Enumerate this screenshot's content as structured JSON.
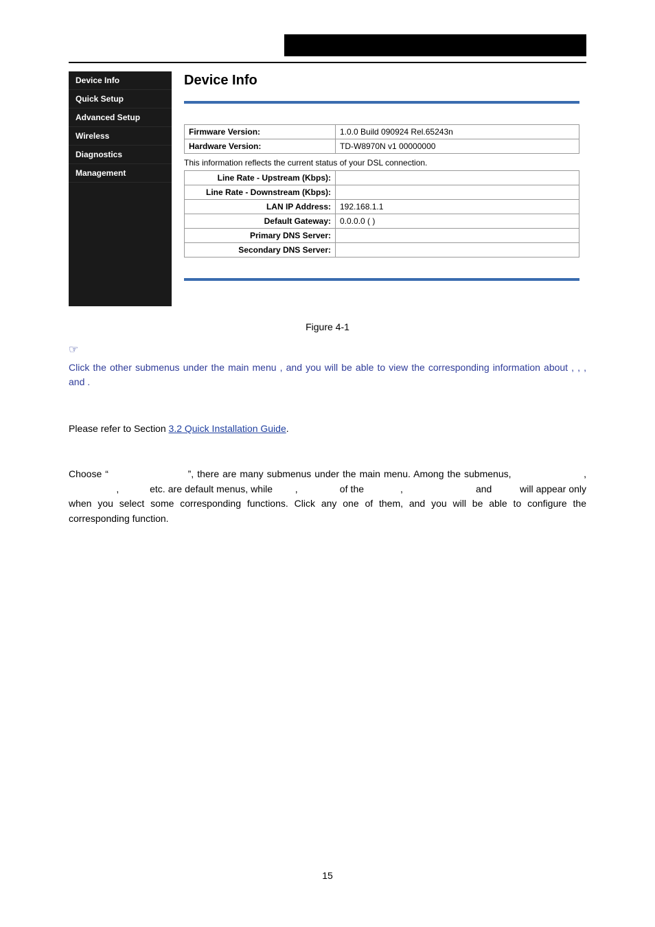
{
  "sidebar": {
    "items": [
      {
        "label": "Device Info"
      },
      {
        "label": "Quick Setup"
      },
      {
        "label": "Advanced Setup"
      },
      {
        "label": "Wireless"
      },
      {
        "label": "Diagnostics"
      },
      {
        "label": "Management"
      }
    ]
  },
  "main": {
    "title": "Device Info",
    "version_table": {
      "firmware_label": "Firmware Version:",
      "firmware_value": "1.0.0 Build 090924 Rel.65243n",
      "hardware_label": "Hardware Version:",
      "hardware_value": "TD-W8970N v1 00000000"
    },
    "status_note": "This information reflects the current status of your DSL connection.",
    "status_table": {
      "up_label": "Line Rate - Upstream (Kbps):",
      "up_value": "",
      "down_label": "Line Rate - Downstream (Kbps):",
      "down_value": "",
      "lan_label": "LAN IP Address:",
      "lan_value": "192.168.1.1",
      "gw_label": "Default Gateway:",
      "gw_value": "0.0.0.0 ( )",
      "dns1_label": "Primary DNS Server:",
      "dns1_value": "",
      "dns2_label": "Secondary DNS Server:",
      "dns2_value": ""
    }
  },
  "fig_caption": "Figure 4-1",
  "note": {
    "line1_a": "Click the other submenus under the main menu ",
    "line1_b": ", and you will be able to view the corresponding information about ",
    "comma": ", ",
    "and": " and ",
    "dot": "."
  },
  "section1": {
    "pre": "Please refer to Section ",
    "link": "3.2 Quick Installation Guide",
    "post": "."
  },
  "section2": {
    "text_a": "Choose “",
    "text_b": "”, there are many submenus under the main menu. Among the submenus, ",
    "text_c": " etc. are default menus, while ",
    "text_d": " of the ",
    "text_e": " and ",
    "text_f": " will appear only when you select some corresponding functions. Click any one of them, and you will be able to configure the corresponding function."
  },
  "page_number": "15"
}
